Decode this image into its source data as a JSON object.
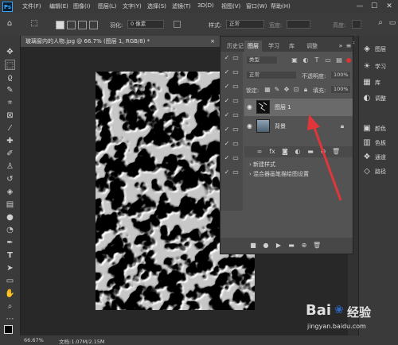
{
  "menubar": {
    "logo": "Ps",
    "items": [
      "文件(F)",
      "编辑(E)",
      "图像(I)",
      "图层(L)",
      "文字(Y)",
      "选择(S)",
      "滤镜(T)",
      "3D(D)",
      "视图(V)",
      "窗口(W)",
      "帮助(H)"
    ],
    "win_min": "—",
    "win_max": "☐",
    "win_close": "✕"
  },
  "options": {
    "feather_label": "羽化:",
    "feather_value": "0 像素",
    "style_label": "样式:",
    "style_value": "正常",
    "width_label": "宽度:",
    "height_label": "高度:"
  },
  "document": {
    "tab_title": "玻璃窗内的人物.jpg @ 66.7% (图层 1, RGB/8) *",
    "tab_close": "×"
  },
  "status": {
    "zoom": "66.67%",
    "doc_info": "文档:1.07M/2.15M"
  },
  "panel": {
    "tabs": [
      "历史记",
      "图层",
      "学习",
      "库",
      "调整"
    ],
    "kind_filter": "类型",
    "blend_mode": "正常",
    "opacity_label": "不透明度:",
    "opacity_value": "100%",
    "lock_label": "锁定:",
    "fill_label": "填充:",
    "fill_value": "100%",
    "layers": [
      {
        "name": "图层 1"
      },
      {
        "name": "背景"
      }
    ],
    "history_items": [
      "新建样式",
      "混合器画笔描绘图设置"
    ]
  },
  "dock": {
    "items": [
      {
        "icon": "layers-icon",
        "label": "图层"
      },
      {
        "icon": "learn-icon",
        "label": "学习"
      },
      {
        "icon": "library-icon",
        "label": "库"
      },
      {
        "icon": "adjust-icon",
        "label": "调整"
      },
      {
        "icon": "color-icon",
        "label": "颜色"
      },
      {
        "icon": "swatches-icon",
        "label": "色板"
      },
      {
        "icon": "channels-icon",
        "label": "通道"
      },
      {
        "icon": "paths-icon",
        "label": "路径"
      }
    ]
  },
  "watermark": {
    "brand": "Bai",
    "brand2": "经验",
    "url": "jingyan.baidu.com"
  },
  "colors": {
    "menubar": "#3a3a3a",
    "workspace": "#282828",
    "panel": "#535353",
    "accent_arrow": "#e0363a",
    "ps_blue": "#31a8ff"
  }
}
